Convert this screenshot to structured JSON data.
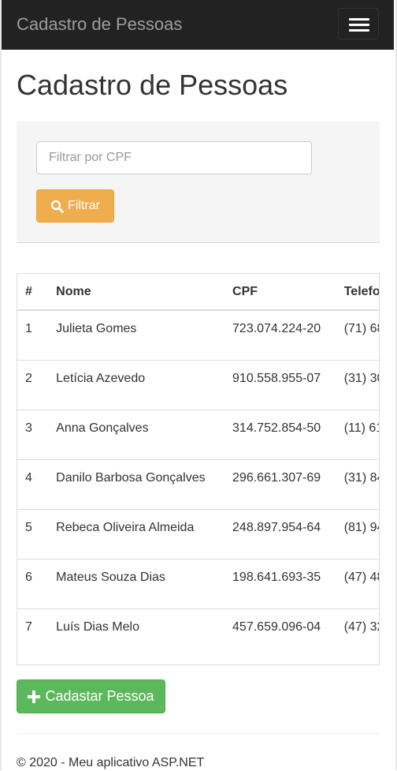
{
  "navbar": {
    "brand": "Cadastro de Pessoas"
  },
  "page": {
    "title": "Cadastro de Pessoas"
  },
  "filter": {
    "placeholder": "Filtrar por CPF",
    "value": "",
    "button_label": "Filtrar"
  },
  "table": {
    "columns": [
      "#",
      "Nome",
      "CPF",
      "Telefo"
    ],
    "rows": [
      {
        "id": "1",
        "nome": "Julieta Gomes",
        "cpf": "723.074.224-20",
        "telefone": "(71) 68"
      },
      {
        "id": "2",
        "nome": "Letícia Azevedo",
        "cpf": "910.558.955-07",
        "telefone": "(31) 30"
      },
      {
        "id": "3",
        "nome": "Anna Gonçalves",
        "cpf": "314.752.854-50",
        "telefone": "(11) 61"
      },
      {
        "id": "4",
        "nome": "Danilo Barbosa Gonçalves",
        "cpf": "296.661.307-69",
        "telefone": "(31) 84"
      },
      {
        "id": "5",
        "nome": "Rebeca Oliveira Almeida",
        "cpf": "248.897.954-64",
        "telefone": "(81) 94"
      },
      {
        "id": "6",
        "nome": "Mateus Souza Dias",
        "cpf": "198.641.693-35",
        "telefone": "(47) 48"
      },
      {
        "id": "7",
        "nome": "Luís Dias Melo",
        "cpf": "457.659.096-04",
        "telefone": "(47) 32"
      }
    ]
  },
  "actions": {
    "add_label": "Cadastar Pessoa"
  },
  "footer": {
    "text": "© 2020 - Meu aplicativo ASP.NET"
  },
  "icons": {
    "filter_icon": "search-icon",
    "add_icon": "plus-icon",
    "menu_icon": "hamburger-menu-icon"
  },
  "colors": {
    "navbar": "#222222",
    "filter_button": "#f0ad4e",
    "add_button": "#5cb85c"
  }
}
